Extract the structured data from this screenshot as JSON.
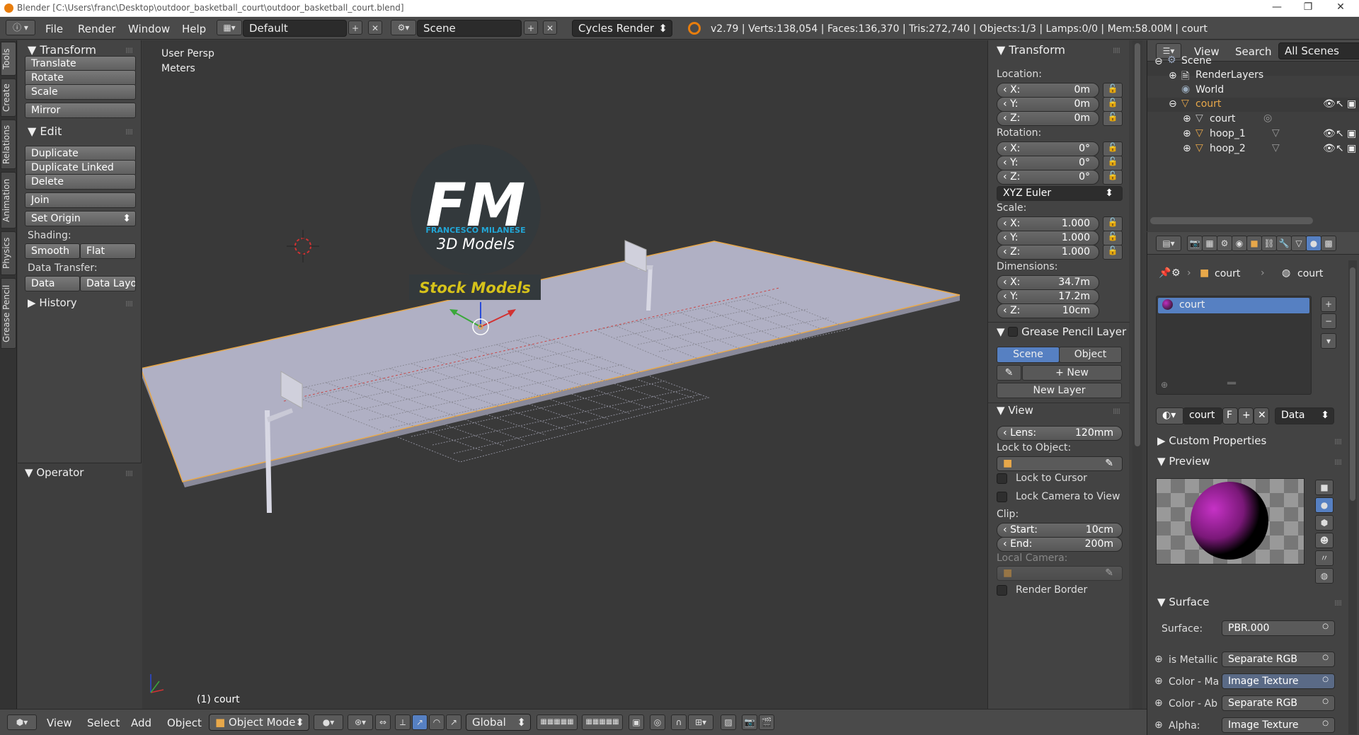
{
  "window": {
    "title": "Blender [C:\\Users\\franc\\Desktop\\outdoor_basketball_court\\outdoor_basketball_court.blend]"
  },
  "menubar": {
    "items": [
      "File",
      "Render",
      "Window",
      "Help"
    ],
    "layout": "Default",
    "scene": "Scene",
    "engine": "Cycles Render",
    "stats": "v2.79 | Verts:138,054 | Faces:136,370 | Tris:272,740 | Objects:1/3 | Lamps:0/0 | Mem:58.00M | court"
  },
  "tabs": [
    "Tools",
    "Create",
    "Relations",
    "Animation",
    "Physics",
    "Grease Pencil"
  ],
  "toolshelf": {
    "transform_title": "Transform",
    "translate": "Translate",
    "rotate": "Rotate",
    "scale": "Scale",
    "mirror": "Mirror",
    "edit_title": "Edit",
    "duplicate": "Duplicate",
    "duplicate_linked": "Duplicate Linked",
    "delete": "Delete",
    "join": "Join",
    "set_origin": "Set Origin",
    "shading_label": "Shading:",
    "smooth": "Smooth",
    "flat": "Flat",
    "data_transfer_label": "Data Transfer:",
    "data": "Data",
    "data_layout": "Data Layo",
    "history": "History",
    "operator": "Operator"
  },
  "viewport": {
    "view_name": "User Persp",
    "units": "Meters",
    "object_label": "(1) court",
    "watermark_initials": "FM",
    "watermark_name": "FRANCESCO MILANESE",
    "watermark_sub": "3D Models",
    "watermark_banner": "Stock Models"
  },
  "npanel": {
    "transform_title": "Transform",
    "location_label": "Location:",
    "loc_x": "0m",
    "loc_y": "0m",
    "loc_z": "0m",
    "rotation_label": "Rotation:",
    "rot_x": "0°",
    "rot_y": "0°",
    "rot_z": "0°",
    "rotation_mode": "XYZ Euler",
    "scale_label": "Scale:",
    "scale_x": "1.000",
    "scale_y": "1.000",
    "scale_z": "1.000",
    "dimensions_label": "Dimensions:",
    "dim_x": "34.7m",
    "dim_y": "17.2m",
    "dim_z": "10cm",
    "x_label": "X:",
    "y_label": "Y:",
    "z_label": "Z:",
    "grease_title": "Grease Pencil Layer",
    "gp_scene": "Scene",
    "gp_object": "Object",
    "gp_new": "New",
    "gp_new_layer": "New Layer",
    "view_title": "View",
    "lens_label": "Lens:",
    "lens_value": "120mm",
    "lock_object_label": "Lock to Object:",
    "lock_cursor": "Lock to Cursor",
    "lock_camera": "Lock Camera to View",
    "clip_label": "Clip:",
    "clip_start_label": "Start:",
    "clip_start": "10cm",
    "clip_end_label": "End:",
    "clip_end": "200m",
    "local_camera": "Local Camera:",
    "render_border": "Render Border"
  },
  "outliner": {
    "view": "View",
    "search": "Search",
    "filter": "All Scenes",
    "items": [
      "Scene",
      "RenderLayers",
      "World",
      "court",
      "court",
      "hoop_1",
      "hoop_2"
    ]
  },
  "properties": {
    "breadcrumb_object": "court",
    "breadcrumb_material": "court",
    "material_slot": "court",
    "material_name": "court",
    "fake_user": "F",
    "link_mode": "Data",
    "custom_properties": "Custom Properties",
    "preview": "Preview",
    "surface_title": "Surface",
    "surface_label": "Surface:",
    "surface_value": "PBR.000",
    "is_metallic_label": "is Metallic",
    "is_metallic_value": "Separate RGB",
    "color_ma_label": "Color - Ma",
    "color_ma_value": "Image Texture",
    "color_ab_label": "Color - Ab",
    "color_ab_value": "Separate RGB",
    "alpha_label": "Alpha:",
    "alpha_value": "Image Texture"
  },
  "bottombar": {
    "view": "View",
    "select": "Select",
    "add": "Add",
    "object": "Object",
    "mode": "Object Mode",
    "orientation": "Global"
  },
  "colors": {
    "accent_blue": "#5680c2",
    "selection_orange": "#e8a84a",
    "court_surface": "#b0b0c4",
    "watermark_circle": "#33393c",
    "watermark_cyan": "#22a6d6",
    "watermark_yellow": "#d6c21a"
  }
}
